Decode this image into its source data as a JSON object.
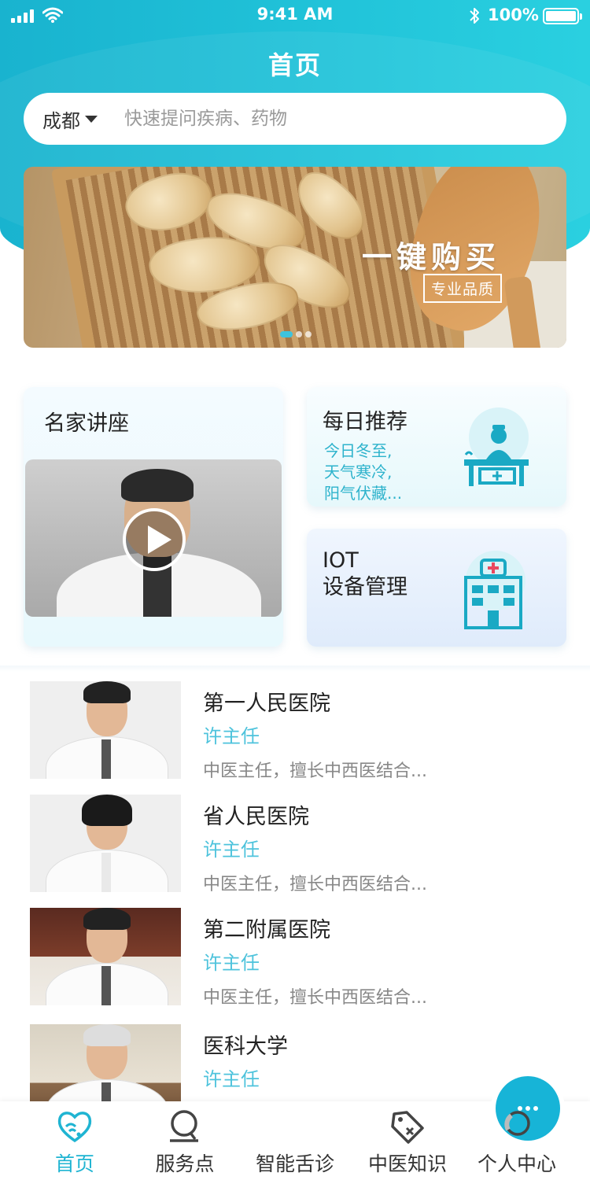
{
  "status_bar": {
    "time": "9:41 AM",
    "battery": "100%"
  },
  "header": {
    "title": "首页"
  },
  "search": {
    "city": "成都",
    "placeholder": "快速提问疾病、药物"
  },
  "banner": {
    "title": "一键购买",
    "badge": "专业品质",
    "slide_count": 3,
    "active_slide": 1
  },
  "cards": {
    "lecture": {
      "title": "名家讲座"
    },
    "daily": {
      "title": "每日推荐",
      "lines": [
        "今日冬至,",
        "天气寒冷,",
        "阳气伏藏..."
      ]
    },
    "iot": {
      "title_line1": "IOT",
      "title_line2": "设备管理"
    }
  },
  "doctors": [
    {
      "hospital": "第一人民医院",
      "title": "许主任",
      "desc": "中医主任，擅长中西医结合..."
    },
    {
      "hospital": "省人民医院",
      "title": "许主任",
      "desc": "中医主任，擅长中西医结合..."
    },
    {
      "hospital": "第二附属医院",
      "title": "许主任",
      "desc": "中医主任，擅长中西医结合..."
    },
    {
      "hospital": "医科大学",
      "title": "许主任",
      "desc": ""
    }
  ],
  "tabbar": {
    "items": [
      {
        "label": "首页",
        "icon": "heart-icon",
        "active": true
      },
      {
        "label": "服务点",
        "icon": "location-icon",
        "active": false
      },
      {
        "label": "智能舌诊",
        "icon": "chat-dots-icon",
        "active": false
      },
      {
        "label": "中医知识",
        "icon": "tag-icon",
        "active": false
      },
      {
        "label": "个人中心",
        "icon": "user-circle-icon",
        "active": false
      }
    ]
  },
  "colors": {
    "accent": "#1fb4d2",
    "header_gradient_start": "#19b3cf",
    "header_gradient_end": "#2ad0e0",
    "subtitle_blue": "#4ec3dc"
  }
}
